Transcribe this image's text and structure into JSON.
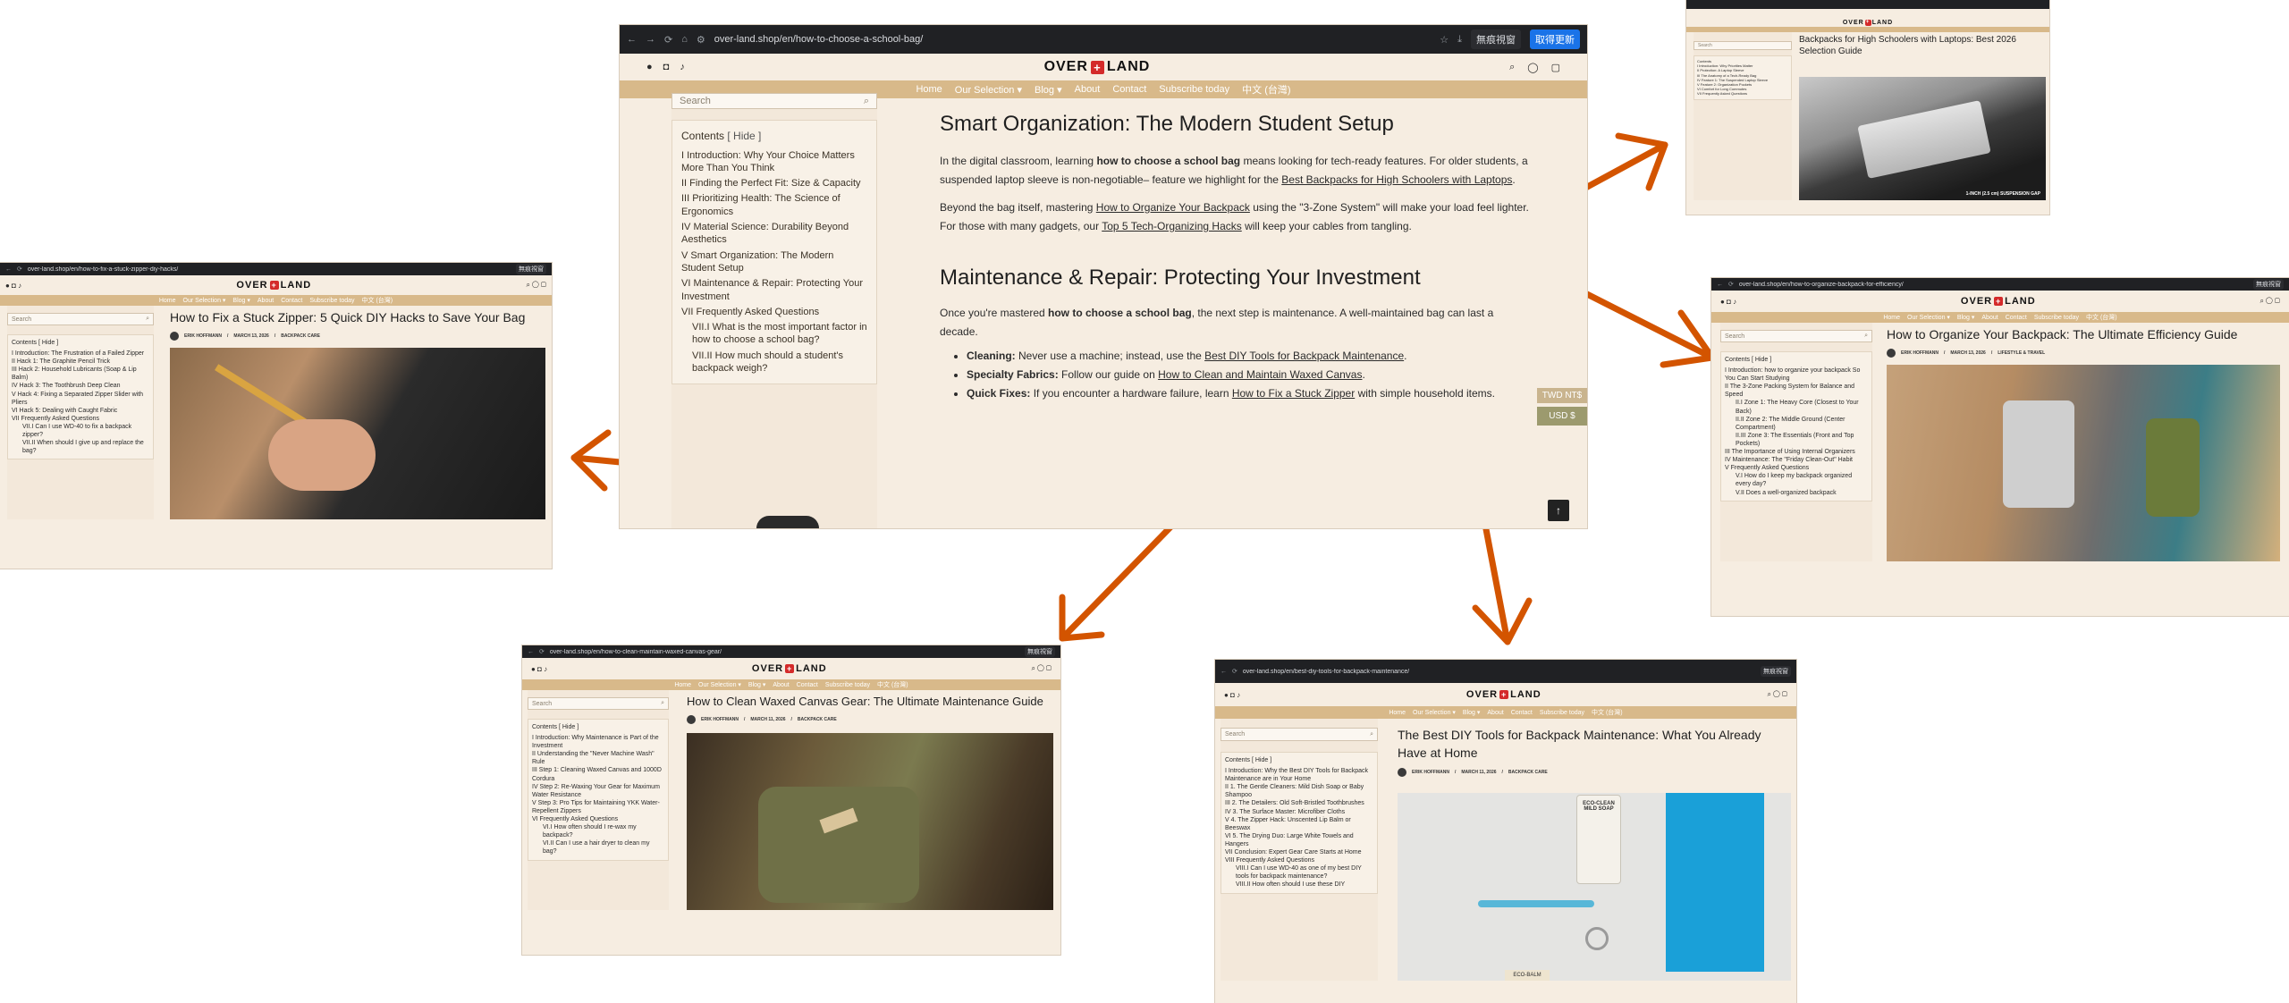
{
  "browser": {
    "guest": "無痕視窗",
    "update": "取得更新"
  },
  "sites": {
    "logo_left": "OVER",
    "logo_cross": "+",
    "logo_right": "LAND"
  },
  "colors": {
    "arrow": "#d35400",
    "menubar": "#d8b98a",
    "page_bg": "#f6ede1",
    "accent": "#d42a2a"
  },
  "main": {
    "url": "over-land.shop/en/how-to-choose-a-school-bag/",
    "guest_label": "無痕視窗",
    "update_label": "取得更新",
    "menu": [
      "Home",
      "Our Selection ▾",
      "Blog ▾",
      "About",
      "Contact",
      "Subscribe today",
      "中文 (台灣)"
    ],
    "search_placeholder": "Search",
    "toc_title": "Contents",
    "toc_hide": "[ Hide ]",
    "toc": [
      "I  Introduction: Why Your Choice Matters More Than You Think",
      "II  Finding the Perfect Fit: Size & Capacity",
      "III  Prioritizing Health: The Science of Ergonomics",
      "IV  Material Science: Durability Beyond Aesthetics",
      "V  Smart Organization: The Modern Student Setup",
      "VI  Maintenance & Repair: Protecting Your Investment",
      "VII  Frequently Asked Questions"
    ],
    "toc_sub": [
      "VII.I  What is the most important factor in how to choose a school bag?",
      "VII.II  How much should a student's backpack weigh?"
    ],
    "h2_org": "Smart Organization: The Modern Student Setup",
    "p1": {
      "a": "In the digital classroom, learning ",
      "b": "how to choose a school bag",
      "c": " means looking for tech-ready features. For older students, a suspended laptop sleeve is non-negotiable– feature we highlight for the ",
      "link": "Best Backpacks for High Schoolers with Laptops",
      "d": "."
    },
    "p2": {
      "a": "Beyond the bag itself, mastering ",
      "link1": "How to Organize Your Backpack",
      "b": " using the \"3-Zone System\" will make your load feel lighter. For those with many gadgets, our ",
      "link2": "Top 5 Tech-Organizing Hacks",
      "c": " will keep your cables from tangling."
    },
    "h2_maint": "Maintenance & Repair: Protecting Your Investment",
    "p3": {
      "a": "Once you're mastered ",
      "b": "how to choose a school bag",
      "c": ", the next step is maintenance. A well-maintained bag can last a decade."
    },
    "bullets": [
      {
        "label": "Cleaning:",
        "text": " Never use a machine; instead, use the ",
        "link": "Best DIY Tools for Backpack Maintenance",
        "end": "."
      },
      {
        "label": "Specialty Fabrics:",
        "text": " Follow our guide on ",
        "link": "How to Clean and Maintain Waxed Canvas",
        "end": "."
      },
      {
        "label": "Quick Fixes:",
        "text": " If you encounter a hardware failure, learn ",
        "link": "How to Fix a Stuck Zipper",
        "end": " with simple household items."
      }
    ],
    "currency": [
      "TWD NT$",
      "USD $"
    ],
    "top_btn": "↑"
  },
  "laptops": {
    "title": "Backpacks for High Schoolers with Laptops: Best 2026 Selection Guide",
    "toc": [
      "I  Introduction: Why Priorities Matter",
      "II  Protection: A Laptop Sleeve",
      "III  The Anatomy of a Tech-Ready Bag",
      "IV  Feature 1: The Suspended Laptop Sleeve",
      "V  Feature 2: Organization Pockets",
      "VI  Comfort for Long Commutes",
      "VII  Frequently Asked Questions"
    ],
    "caption": "1-INCH (2.5 cm) SUSPENSION GAP"
  },
  "organize": {
    "url": "over-land.shop/en/how-to-organize-backpack-for-efficiency/",
    "title": "How to Organize Your Backpack: The Ultimate Efficiency Guide",
    "author": "ERIK HOFFMANN",
    "date": "MARCH 13, 2026",
    "cat": "LIFESTYLE & TRAVEL",
    "toc": [
      "I  Introduction: how to organize your backpack So You Can Start Studying",
      "II  The 3-Zone Packing System for Balance and Speed",
      "II.I  Zone 1: The Heavy Core (Closest to Your Back)",
      "II.II  Zone 2: The Middle Ground (Center Compartment)",
      "II.III  Zone 3: The Essentials (Front and Top Pockets)",
      "III  The Importance of Using Internal Organizers",
      "IV  Maintenance: The \"Friday Clean-Out\" Habit",
      "V  Frequently Asked Questions",
      "V.I  How do I keep my backpack organized every day?",
      "V.II  Does a well-organized backpack"
    ]
  },
  "zipper": {
    "url": "over-land.shop/en/how-to-fix-a-stuck-zipper-diy-hacks/",
    "title": "How to Fix a Stuck Zipper: 5 Quick DIY Hacks to Save Your Bag",
    "author": "ERIK HOFFMANN",
    "date": "MARCH 13, 2026",
    "cat": "BACKPACK CARE",
    "toc": [
      "I  Introduction: The Frustration of a Failed Zipper",
      "II  Hack 1: The Graphite Pencil Trick",
      "III  Hack 2: Household Lubricants (Soap & Lip Balm)",
      "IV  Hack 3: The Toothbrush Deep Clean",
      "V  Hack 4: Fixing a Separated Zipper Slider with Pliers",
      "VI  Hack 5: Dealing with Caught Fabric",
      "VII  Frequently Asked Questions",
      "VII.I  Can I use WD-40 to fix a backpack zipper?",
      "VII.II  When should I give up and replace the bag?"
    ]
  },
  "waxed": {
    "url": "over-land.shop/en/how-to-clean-maintain-waxed-canvas-gear/",
    "title": "How to Clean Waxed Canvas Gear: The Ultimate Maintenance Guide",
    "author": "ERIK HOFFMANN",
    "date": "MARCH 11, 2026",
    "cat": "BACKPACK CARE",
    "toc": [
      "I  Introduction: Why Maintenance is Part of the Investment",
      "II  Understanding the \"Never Machine Wash\" Rule",
      "III  Step 1: Cleaning Waxed Canvas and 1000D Cordura",
      "IV  Step 2: Re-Waxing Your Gear for Maximum Water Resistance",
      "V  Step 3: Pro Tips for Maintaining YKK Water-Repellent Zippers",
      "VI  Frequently Asked Questions",
      "VI.I  How often should I re-wax my backpack?",
      "VI.II  Can I use a hair dryer to clean my bag?"
    ]
  },
  "diy": {
    "url": "over-land.shop/en/best-diy-tools-for-backpack-maintenance/",
    "title": "The Best DIY Tools for Backpack Maintenance: What You Already Have at Home",
    "author": "ERIK HOFFMANN",
    "date": "MARCH 11, 2026",
    "cat": "BACKPACK CARE",
    "toc": [
      "I  Introduction: Why the Best DIY Tools for Backpack Maintenance are in Your Home",
      "II  1. The Gentle Cleaners: Mild Dish Soap or Baby Shampoo",
      "III  2. The Detailers: Old Soft-Bristled Toothbrushes",
      "IV  3. The Surface Master: Microfiber Cloths",
      "V  4. The Zipper Hack: Unscented Lip Balm or Beeswax",
      "VI  5. The Drying Duo: Large White Towels and Hangers",
      "VII  Conclusion: Expert Gear Care Starts at Home",
      "VIII  Frequently Asked Questions",
      "VIII.I  Can I use WD-40 as one of my best DIY tools for backpack maintenance?",
      "VIII.II  How often should I use these DIY"
    ],
    "soap": "ECO-CLEAN MILD SOAP",
    "balm": "ECO-BALM"
  }
}
